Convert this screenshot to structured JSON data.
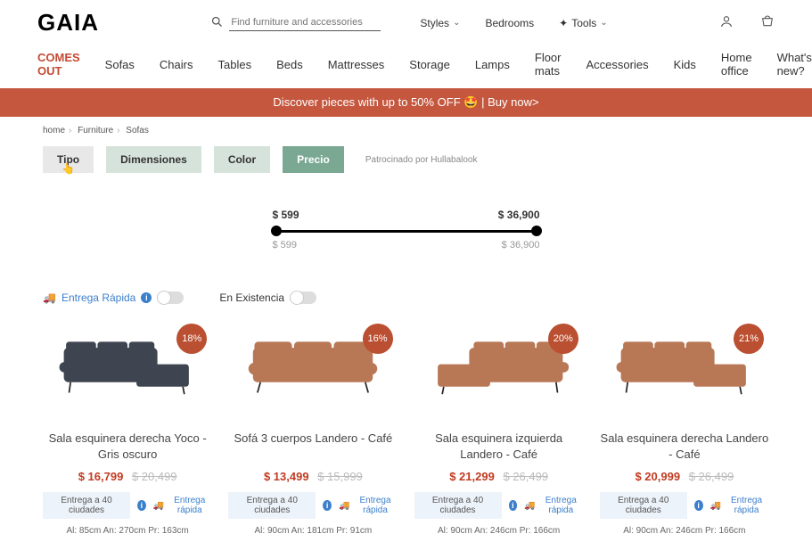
{
  "header": {
    "logo": "GAIA",
    "search_placeholder": "Find furniture and accessories",
    "links": {
      "styles": "Styles",
      "bedrooms": "Bedrooms",
      "tools": "Tools"
    }
  },
  "nav": {
    "comes_out": "COMES OUT",
    "items": [
      "Sofas",
      "Chairs",
      "Tables",
      "Beds",
      "Mattresses",
      "Storage",
      "Lamps",
      "Floor mats",
      "Accessories",
      "Kids",
      "Home office",
      "What's new?"
    ]
  },
  "promo": {
    "text": "Discover pieces with up to 50% OFF",
    "action": "Buy now>"
  },
  "crumbs": {
    "home": "home",
    "furniture": "Furniture",
    "sofas": "Sofas"
  },
  "filters": {
    "tipo": "Tipo",
    "dimensiones": "Dimensiones",
    "color": "Color",
    "precio": "Precio",
    "sponsor": "Patrocinado por Hullabalook"
  },
  "slider": {
    "min": "$ 599",
    "max": "$ 36,900",
    "gmin": "$ 599",
    "gmax": "$ 36,900"
  },
  "toggles": {
    "fast": "Entrega Rápida",
    "stock": "En Existencia"
  },
  "grid_labels": {
    "delivery_pill": "Entrega a 40 ciudades",
    "fast_ship": "Entrega rápida"
  },
  "products": [
    {
      "badge": "18%",
      "name": "Sala esquinera derecha Yoco - Gris oscuro",
      "price": "$ 16,799",
      "old": "$ 20,499",
      "dims": "Al: 85cm   An: 270cm   Pr: 163cm",
      "variant": "dark",
      "shape": "right"
    },
    {
      "badge": "16%",
      "name": "Sofá 3 cuerpos Landero - Café",
      "price": "$ 13,499",
      "old": "$ 15,999",
      "dims": "Al: 90cm   An: 181cm   Pr: 91cm",
      "variant": "tan",
      "shape": "flat"
    },
    {
      "badge": "20%",
      "name": "Sala esquinera izquierda Landero - Café",
      "price": "$ 21,299",
      "old": "$ 26,499",
      "dims": "Al: 90cm   An: 246cm   Pr: 166cm",
      "variant": "tan",
      "shape": "left"
    },
    {
      "badge": "21%",
      "name": "Sala esquinera derecha Landero - Café",
      "price": "$ 20,999",
      "old": "$ 26,499",
      "dims": "Al: 90cm   An: 246cm   Pr: 166cm",
      "variant": "tan",
      "shape": "right"
    }
  ]
}
